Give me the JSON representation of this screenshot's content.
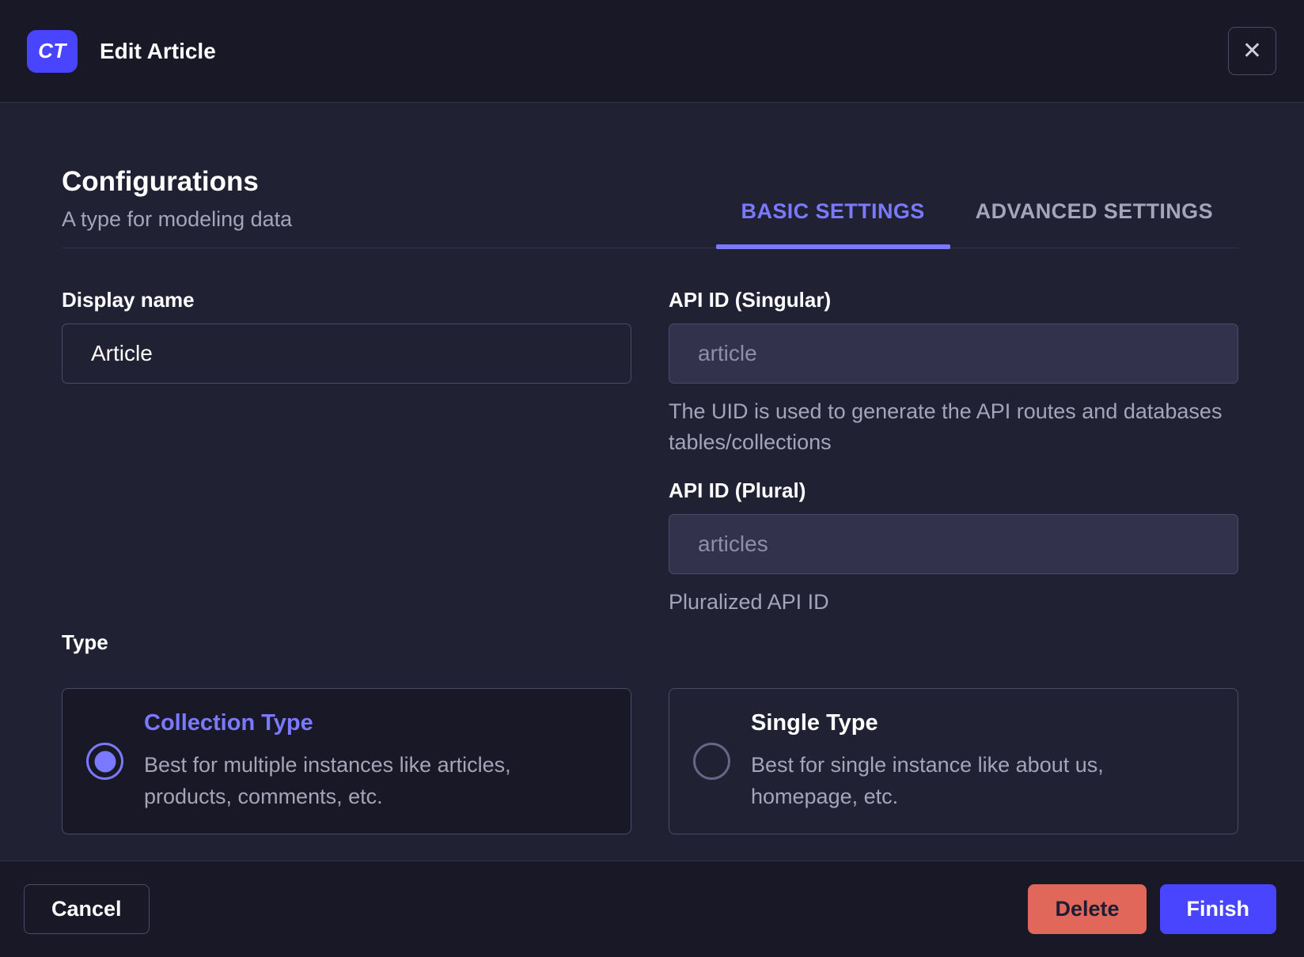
{
  "modal": {
    "badge": "CT",
    "title": "Edit Article",
    "close_icon": "✕"
  },
  "section": {
    "heading": "Configurations",
    "subheading": "A type for modeling data",
    "tabs": [
      {
        "label": "BASIC SETTINGS",
        "active": true
      },
      {
        "label": "ADVANCED SETTINGS",
        "active": false
      }
    ]
  },
  "form": {
    "display_name": {
      "label": "Display name",
      "value": "Article"
    },
    "api_id_singular": {
      "label": "API ID (Singular)",
      "value": "article",
      "hint": "The UID is used to generate the API routes and databases tables/collections",
      "disabled": true
    },
    "api_id_plural": {
      "label": "API ID (Plural)",
      "value": "articles",
      "hint": "Pluralized API ID",
      "disabled": true
    },
    "type": {
      "label": "Type",
      "options": [
        {
          "title": "Collection Type",
          "description": "Best for multiple instances like articles, products, comments, etc.",
          "selected": true
        },
        {
          "title": "Single Type",
          "description": "Best for single instance like about us, homepage, etc.",
          "selected": false
        }
      ]
    }
  },
  "footer": {
    "cancel_label": "Cancel",
    "delete_label": "Delete",
    "finish_label": "Finish"
  },
  "colors": {
    "primary": "#4945ff",
    "accent_text": "#7b79ff",
    "danger": "#e0675a",
    "body_bg": "#212134",
    "chrome_bg": "#181826",
    "border": "#4a4a6a",
    "muted_text": "#a5a5ba"
  }
}
